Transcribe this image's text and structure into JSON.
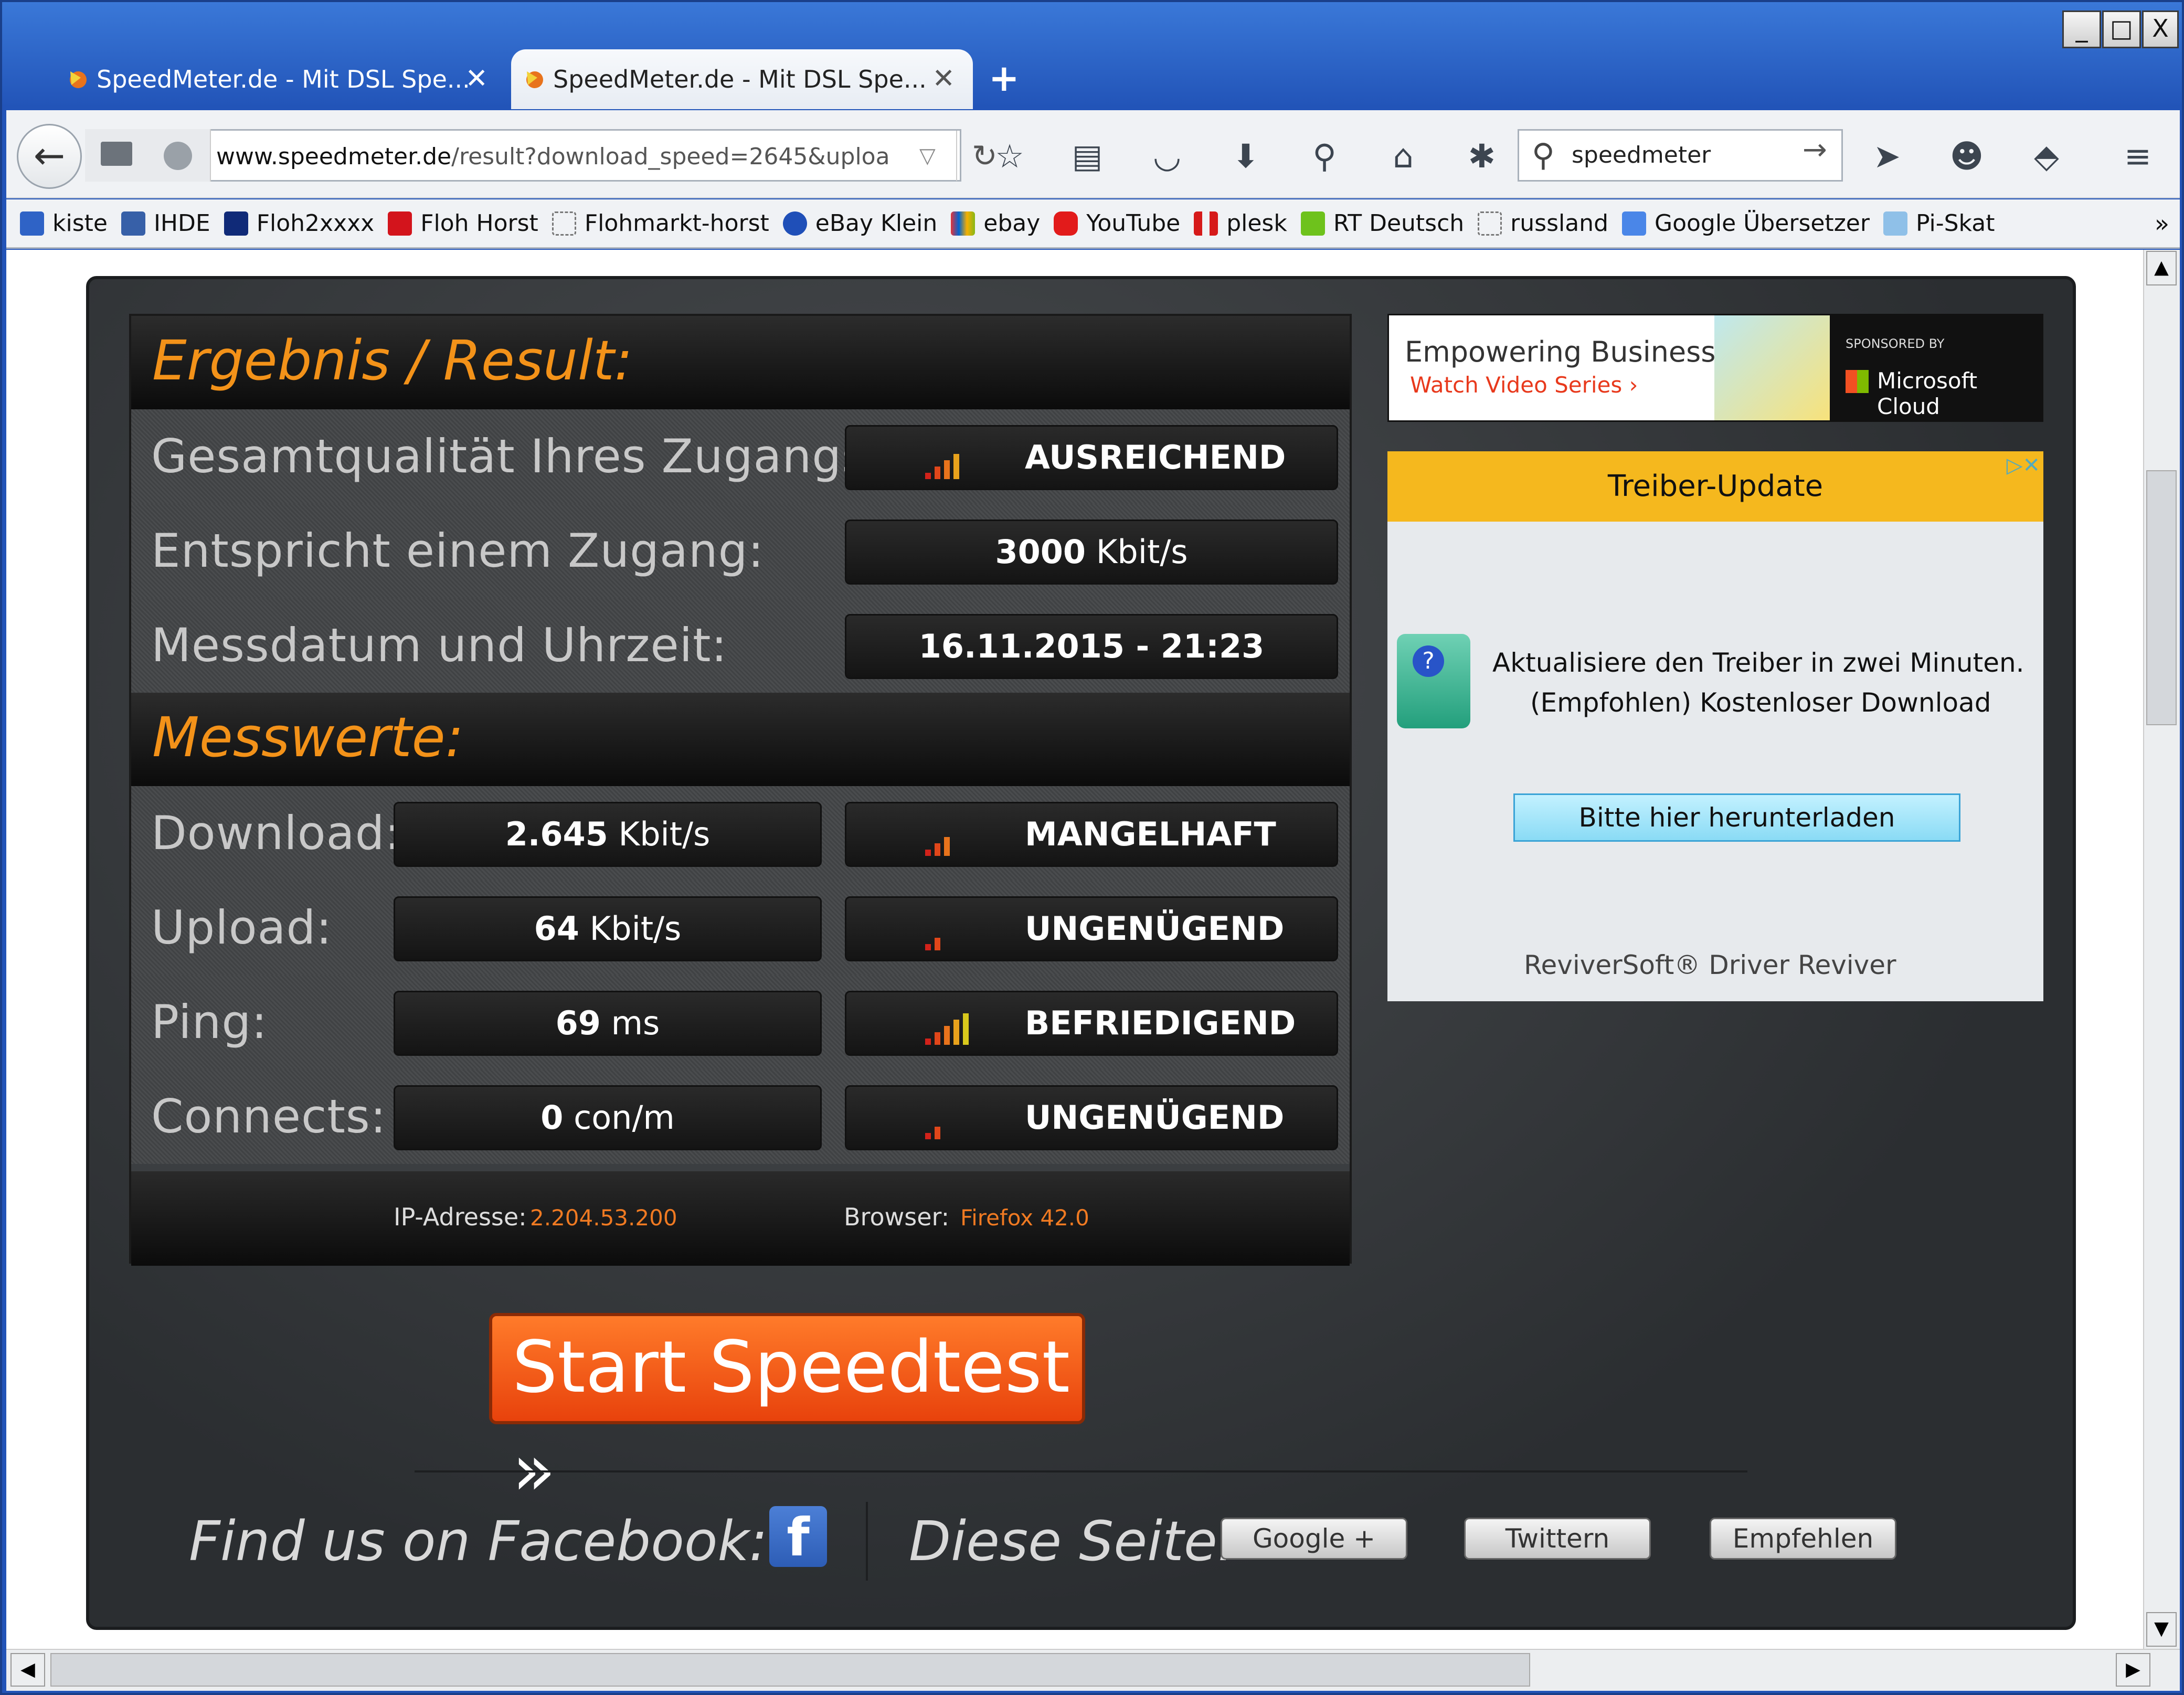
{
  "window": {
    "min": "_",
    "max": "□",
    "close": "X"
  },
  "tabs": [
    {
      "title": "SpeedMeter.de - Mit DSL Spe...",
      "close": "✕"
    },
    {
      "title": "SpeedMeter.de - Mit DSL Spe...",
      "close": "✕"
    }
  ],
  "newtab": "+",
  "nav": {
    "back": "←",
    "url_host": "www.speedmeter.de",
    "url_path": "/result?download_speed=2645&uploa",
    "search": "speedmeter"
  },
  "bookmarks": [
    "kiste",
    "IHDE",
    "Floh2xxxx",
    "Floh Horst",
    "Flohmarkt-horst",
    "eBay Klein",
    "ebay",
    "YouTube",
    "plesk",
    "RT Deutsch",
    "russland",
    "Google Übersetzer",
    "Pi-Skat"
  ],
  "bookmarks_more": "»",
  "result": {
    "heading": "Ergebnis / Result:",
    "rows": [
      {
        "label": "Gesamtqualität Ihres Zugangs:",
        "value": "AUSREICHEND"
      },
      {
        "label": "Entspricht einem Zugang:",
        "value_bold": "3000",
        "value_unit": "Kbit/s"
      },
      {
        "label": "Messdatum und Uhrzeit:",
        "value": "16.11.2015 - 21:23"
      }
    ],
    "heading2": "Messwerte:",
    "measures": [
      {
        "label": "Download:",
        "num": "2.645",
        "unit": "Kbit/s",
        "rating": "MANGELHAFT"
      },
      {
        "label": "Upload:",
        "num": "64",
        "unit": "Kbit/s",
        "rating": "UNGENÜGEND"
      },
      {
        "label": "Ping:",
        "num": "69",
        "unit": "ms",
        "rating": "BEFRIEDIGEND"
      },
      {
        "label": "Connects:",
        "num": "0",
        "unit": "con/m",
        "rating": "UNGENÜGEND"
      }
    ],
    "ip_label": "IP-Adresse:",
    "ip": "2.204.53.200",
    "browser_label": "Browser:",
    "browser": "Firefox 42.0"
  },
  "start": "Start Speedtest »",
  "social": {
    "facebook": "Find us on Facebook:",
    "fb": "f",
    "page": "Diese Seite:",
    "google": "Google +",
    "twitter": "Twittern",
    "empfehlen": "Empfehlen"
  },
  "ad1": {
    "title": "Empowering Business",
    "sub": "Watch Video Series ›",
    "sponsored": "SPONSORED BY",
    "brand": "Microsoft Cloud"
  },
  "ad2": {
    "top": "Treiber-Update",
    "text1": "Aktualisiere den Treiber in zwei Minuten.",
    "text2": "(Empfohlen) Kostenloser Download",
    "button": "Bitte hier herunterladen",
    "footer": "ReviverSoft® Driver Reviver"
  }
}
